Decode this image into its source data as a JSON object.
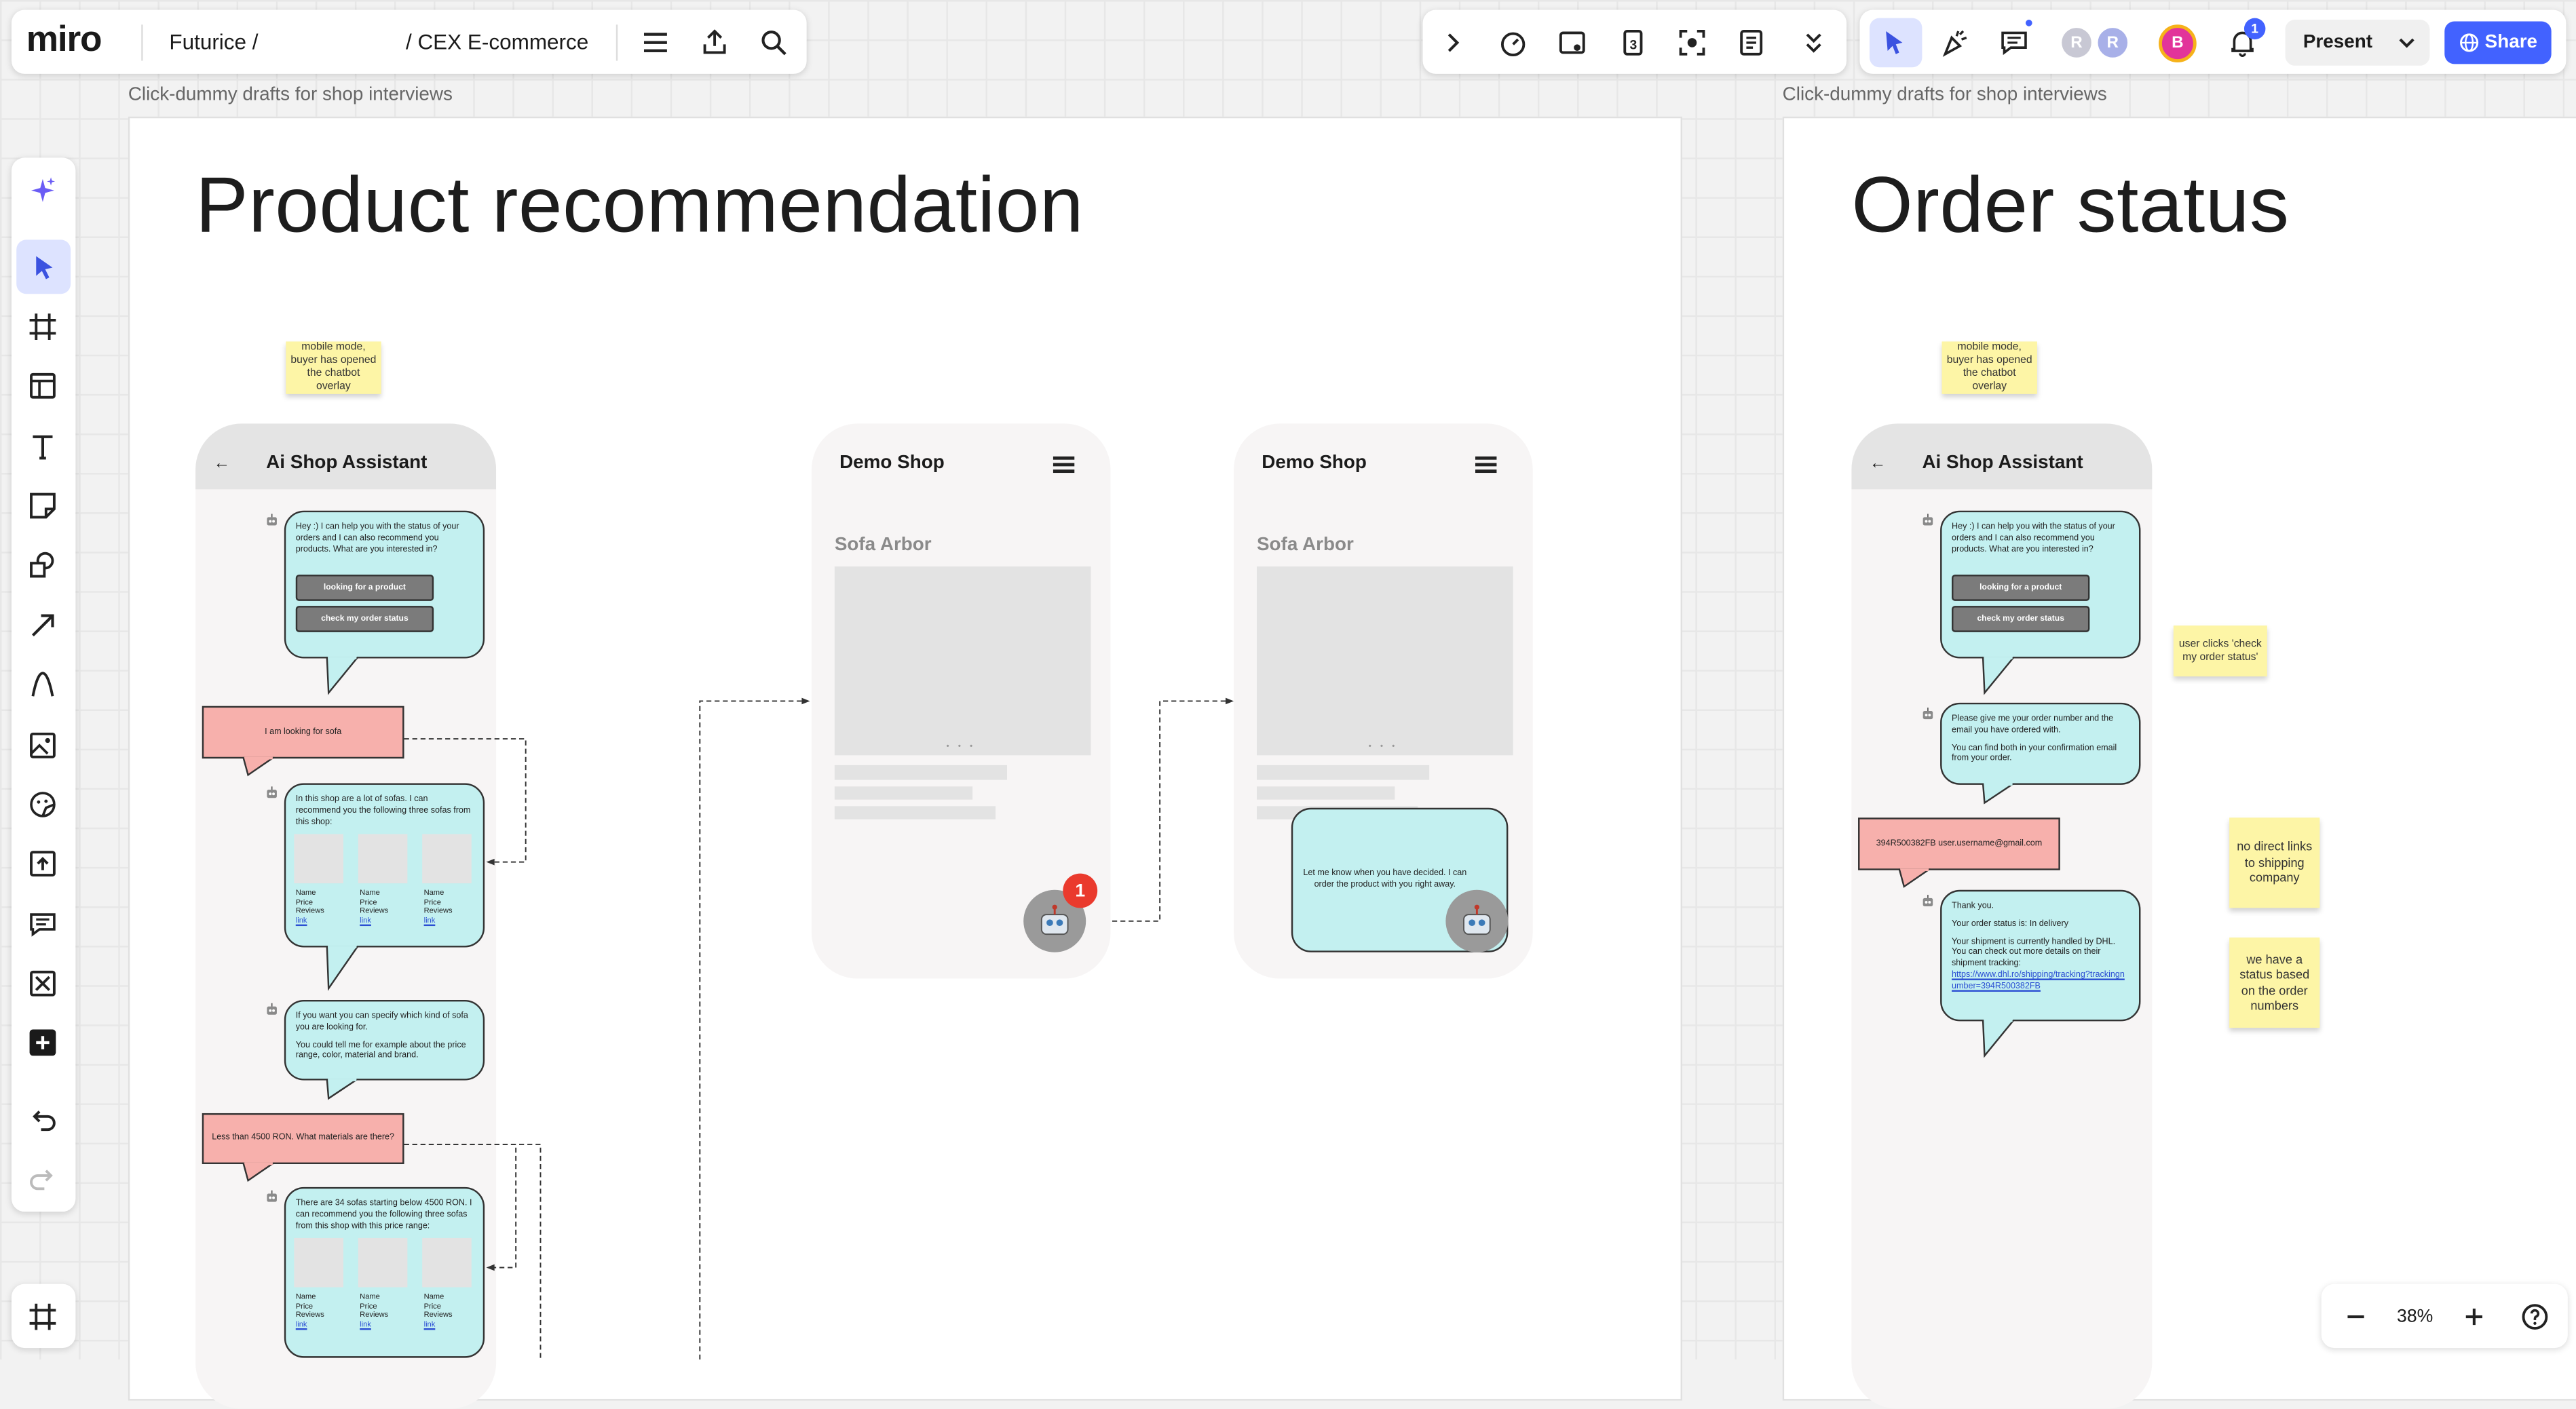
{
  "app": {
    "logo": "miro",
    "breadcrumb_root": "Futurice /",
    "breadcrumb_board": "/ CEX E-commerce"
  },
  "toolbar_right": {
    "present_label": "Present",
    "share_label": "Share",
    "notification_count": "1",
    "avatars": [
      "R",
      "R",
      "B"
    ]
  },
  "zoom": {
    "level": "38%"
  },
  "frames": [
    {
      "label": "Click-dummy drafts for shop interviews",
      "title": "Product recommendation"
    },
    {
      "label": "Click-dummy drafts for shop interviews",
      "title": "Order status"
    }
  ],
  "rec": {
    "sticky": "mobile mode, buyer has opened the chatbot overlay",
    "phone_title": "Ai Shop Assistant",
    "back": "←",
    "bot1": "Hey :) I can help you with the status of your orders and I can also recommend you products. What are you interested in?",
    "btn1": "looking for a product",
    "btn2": "check my order status",
    "user1": "I am looking for sofa",
    "bot2": "In this shop are a lot of sofas. I can recommend you the following three sofas from this shop:",
    "product_lines": [
      "Name",
      "Price",
      "Reviews",
      "link"
    ],
    "bot3a": "If you want you can specify which kind of sofa you are looking for.",
    "bot3b": "You could tell me for example about the price range, color, material and brand.",
    "user2": "Less than 4500 RON. What materials are there?",
    "bot4": "There are 34 sofas starting below 4500 RON. I can recommend you the following three sofas from this shop with this price range:"
  },
  "demo": {
    "shop_title": "Demo Shop",
    "product_title": "Sofa Arbor",
    "badge": "1",
    "bot_msg": "Let me know when you have decided. I can order the product with you right away."
  },
  "order": {
    "sticky": "mobile mode, buyer has opened the chatbot overlay",
    "phone_title": "Ai Shop Assistant",
    "bot1": "Hey :) I can help you with the status of your orders and I can also recommend you products. What are you interested in?",
    "btn1": "looking for a product",
    "btn2": "check my order status",
    "bot2a": "Please give me your order number and the email you have ordered with.",
    "bot2b": "You can find both in your confirmation email from your order.",
    "user1": "394R500382FB user.username@gmail.com",
    "bot3a": "Thank you.",
    "bot3b": "Your order status is: In delivery",
    "bot3c": "Your shipment is currently handled by DHL. You can check out more details on their shipment tracking:",
    "bot3link": "https://www.dhl.ro/shipping/tracking?trackingnumber=394R500382FB",
    "note_clicks": "user clicks 'check my order status'",
    "note_links": "no direct links to shipping company",
    "note_status": "we have a status based on the order numbers"
  },
  "colors": {
    "accent": "#4262ff",
    "bubble": "#c3f0f0",
    "user_bubble": "#f7b0ac",
    "sticky": "#fdf5a6"
  }
}
